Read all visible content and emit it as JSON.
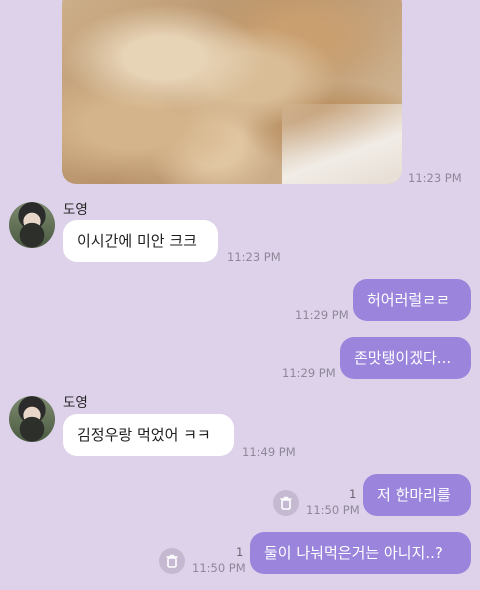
{
  "photo_time": "11:23 PM",
  "messages": [
    {
      "sender": "도영",
      "text": "이시간에 미안 크크",
      "time": "11:23 PM"
    },
    {
      "text": "허어러럴ㄹㄹ",
      "time": "11:29 PM"
    },
    {
      "text": "존맛탱이겠다...",
      "time": "11:29 PM"
    },
    {
      "sender": "도영",
      "text": "김정우랑 먹었어 ㅋㅋ",
      "time": "11:49 PM"
    },
    {
      "text": "저 한마리를",
      "time": "11:50 PM",
      "unread": "1"
    },
    {
      "text": "둘이 나눠먹은거는 아니지..?",
      "time": "11:50 PM",
      "unread": "1"
    }
  ],
  "icons": [
    "avatar",
    "trash-icon"
  ]
}
